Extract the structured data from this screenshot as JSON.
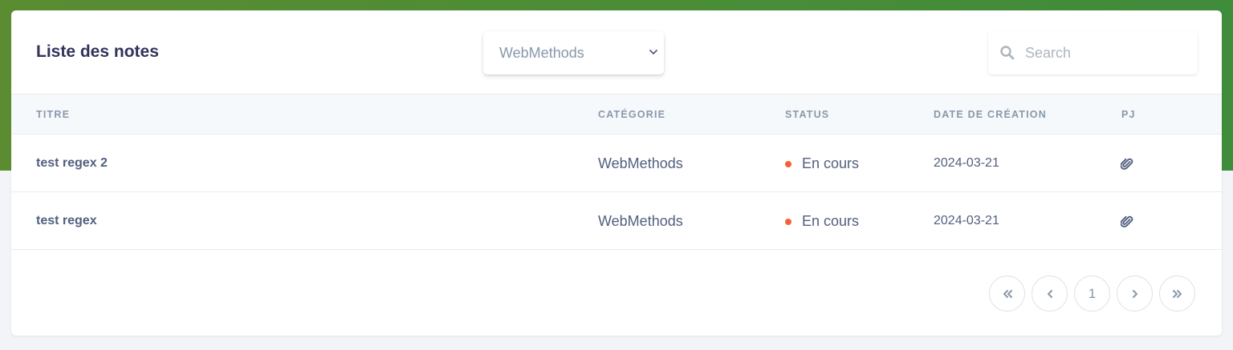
{
  "card": {
    "title": "Liste des notes"
  },
  "filter": {
    "selected": "WebMethods",
    "chevron_icon": "chevron-down-icon"
  },
  "search": {
    "placeholder": "Search",
    "value": "",
    "icon": "search-icon"
  },
  "table": {
    "columns": [
      "TITRE",
      "CATÉGORIE",
      "STATUS",
      "DATE DE CRÉATION",
      "PJ"
    ],
    "rows": [
      {
        "titre": "test regex 2",
        "categorie": "WebMethods",
        "status": "En cours",
        "date": "2024-03-21",
        "pj_icon": "paperclip-icon"
      },
      {
        "titre": "test regex",
        "categorie": "WebMethods",
        "status": "En cours",
        "date": "2024-03-21",
        "pj_icon": "paperclip-icon"
      }
    ]
  },
  "pagination": {
    "first_icon": "double-chevron-left-icon",
    "prev_icon": "chevron-left-icon",
    "current_page": "1",
    "next_icon": "chevron-right-icon",
    "last_icon": "double-chevron-right-icon"
  },
  "colors": {
    "header_green": "#4b8d36",
    "status_dot": "#f5603a",
    "title_text": "#32325d",
    "muted_text": "#8898aa"
  }
}
